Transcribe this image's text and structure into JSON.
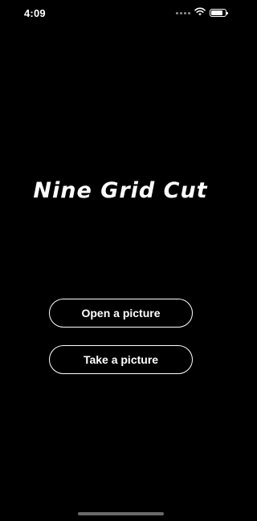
{
  "status_bar": {
    "time": "4:09",
    "icons": [
      "cellular-signal-icon",
      "wifi-icon",
      "battery-icon"
    ],
    "battery_level": 0.85
  },
  "app": {
    "title": "Nine Grid Cut"
  },
  "actions": {
    "open_label": "Open a picture",
    "take_label": "Take a picture"
  },
  "colors": {
    "background": "#000000",
    "foreground": "#ffffff",
    "home_indicator": "#6a6a6a"
  }
}
